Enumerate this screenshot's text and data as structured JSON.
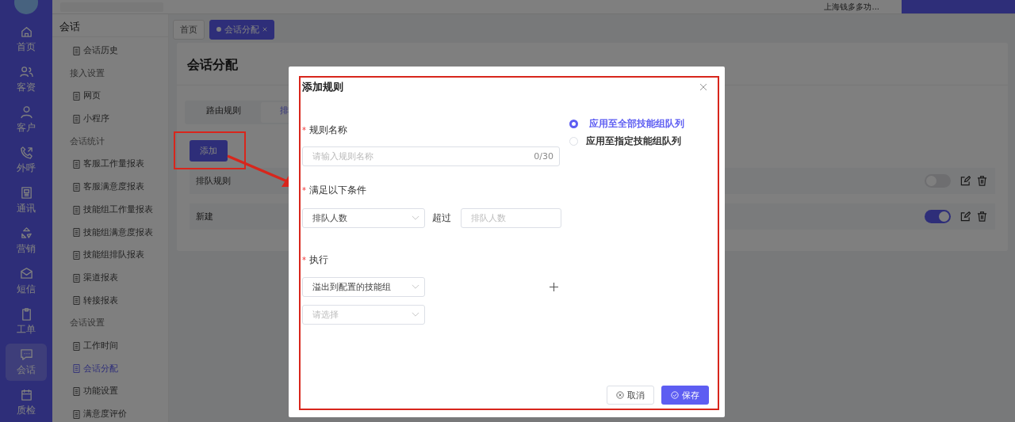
{
  "top_bar": {
    "account": "上海钱多多功..."
  },
  "nav": [
    {
      "label": "首页",
      "selected": false
    },
    {
      "label": "客资",
      "selected": false
    },
    {
      "label": "客户",
      "selected": false
    },
    {
      "label": "外呼",
      "selected": false
    },
    {
      "label": "通讯",
      "selected": false
    },
    {
      "label": "营销",
      "selected": false
    },
    {
      "label": "短信",
      "selected": false
    },
    {
      "label": "工单",
      "selected": false
    },
    {
      "label": "会话",
      "selected": true
    },
    {
      "label": "质检",
      "selected": false
    }
  ],
  "submenu": {
    "title": "会话",
    "items": [
      {
        "kind": "item",
        "label": "会话历史",
        "selected": false
      },
      {
        "kind": "header",
        "label": "接入设置"
      },
      {
        "kind": "item",
        "label": "网页",
        "selected": false
      },
      {
        "kind": "item",
        "label": "小程序",
        "selected": false
      },
      {
        "kind": "header",
        "label": "会话统计"
      },
      {
        "kind": "item",
        "label": "客服工作量报表",
        "selected": false
      },
      {
        "kind": "item",
        "label": "客服满意度报表",
        "selected": false
      },
      {
        "kind": "item",
        "label": "技能组工作量报表",
        "selected": false
      },
      {
        "kind": "item",
        "label": "技能组满意度报表",
        "selected": false
      },
      {
        "kind": "item",
        "label": "技能组排队报表",
        "selected": false
      },
      {
        "kind": "item",
        "label": "渠道报表",
        "selected": false
      },
      {
        "kind": "item",
        "label": "转接报表",
        "selected": false
      },
      {
        "kind": "header",
        "label": "会话设置"
      },
      {
        "kind": "item",
        "label": "工作时间",
        "selected": false
      },
      {
        "kind": "item",
        "label": "会话分配",
        "selected": true
      },
      {
        "kind": "item",
        "label": "功能设置",
        "selected": false
      },
      {
        "kind": "item",
        "label": "满意度评价",
        "selected": false
      }
    ]
  },
  "page_tabs": [
    {
      "label": "首页",
      "selected": false,
      "closable": false
    },
    {
      "label": "会话分配",
      "selected": true,
      "closable": true
    }
  ],
  "content": {
    "title": "会话分配",
    "tabs": [
      {
        "label": "路由规则",
        "selected": false
      },
      {
        "label": "排",
        "selected": true
      }
    ],
    "add_button": "添加",
    "rules": [
      {
        "name": "排队规则",
        "on": false
      },
      {
        "name": "新建",
        "on": true
      }
    ]
  },
  "dialog": {
    "title": "添加规则",
    "name_field": {
      "required_mark": "*",
      "label": "规则名称",
      "placeholder": "请输入规则名称",
      "counter": "0/30"
    },
    "condition": {
      "required_mark": "*",
      "label": "满足以下条件",
      "metric": "排队人数",
      "operator": "超过",
      "placeholder": "排队人数"
    },
    "action": {
      "required_mark": "*",
      "label": "执行",
      "select": "溢出到配置的技能组",
      "placeholder": "请选择"
    },
    "scope": [
      {
        "label": "应用至全部技能组队列",
        "selected": true
      },
      {
        "label": "应用至指定技能组队列",
        "selected": false
      }
    ],
    "cancel": "取消",
    "save": "保存"
  }
}
